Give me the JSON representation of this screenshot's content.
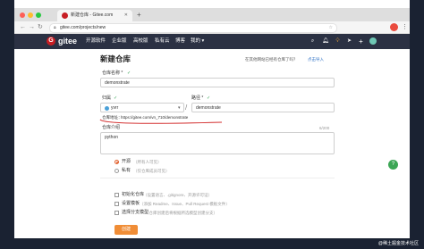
{
  "browser": {
    "tab_title": "新建仓库 - Gitee.com",
    "tab_close": "✕",
    "new_tab": "+",
    "url": "gitee.com/projects/new",
    "nav": {
      "back": "←",
      "forward": "→",
      "reload": "↻"
    },
    "menu": "⋮"
  },
  "header": {
    "logo_mark": "G",
    "logo_text": "gitee",
    "nav_items": [
      "开源软件",
      "企业版",
      "高校版",
      "私有云",
      "博客",
      "我的 ▾"
    ],
    "plus": "+"
  },
  "form": {
    "title": "新建仓库",
    "import_link": "在其他网站已经有仓库了吗？",
    "import_link2": "点击导入",
    "repo_name_label": "仓库名称 *",
    "repo_name_value": "demonstrate",
    "owner_label": "归属",
    "owner_value": "yvrr",
    "path_label": "路径 *",
    "path_value": "demonstrate",
    "slash": "/",
    "address_label": "仓库地址：",
    "address_value": "https://gitee.com/vn_710/demonstrate",
    "desc_label": "仓库介绍",
    "desc_count": "6/200",
    "desc_value": "python",
    "visibility": [
      {
        "label": "开源",
        "hint": "（所有人可见）",
        "selected": true
      },
      {
        "label": "私有",
        "hint": "（仅仓库成员可见）",
        "selected": false
      }
    ],
    "options": [
      {
        "label": "初始化仓库",
        "hint": "（设置语言、.gitignore、开源许可证）"
      },
      {
        "label": "设置模板",
        "hint": "（添加 Readme、Issue、Pull Request 模板文件）"
      },
      {
        "label": "选择分支模型",
        "hint": "（仓库创建后将根据所选模型创建分支）"
      }
    ],
    "create_label": "创建"
  },
  "help": "?",
  "watermark": "@稀土掘金技术社区",
  "colors": {
    "brand_red": "#c71d23",
    "header_bg": "#2b3143",
    "accent_orange": "#f08d36",
    "success_green": "#2a9d4a",
    "annotation_red": "#d32f2f"
  }
}
